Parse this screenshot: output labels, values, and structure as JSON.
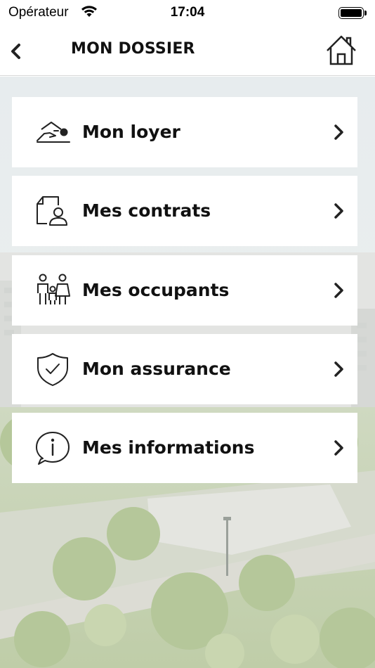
{
  "status_bar": {
    "carrier": "Opérateur",
    "time": "17:04"
  },
  "nav": {
    "title": "MON DOSSIER",
    "back_icon": "chevron-left-icon",
    "home_icon": "home-icon"
  },
  "menu": {
    "items": [
      {
        "label": "Mon loyer",
        "icon": "rent-hand-icon"
      },
      {
        "label": "Mes contrats",
        "icon": "contract-document-icon"
      },
      {
        "label": "Mes occupants",
        "icon": "family-icon"
      },
      {
        "label": "Mon assurance",
        "icon": "shield-check-icon"
      },
      {
        "label": "Mes informations",
        "icon": "info-bubble-icon"
      }
    ]
  },
  "colors": {
    "card_background": "#ffffff",
    "text": "#111111",
    "background_tint": "#e8eee6"
  }
}
